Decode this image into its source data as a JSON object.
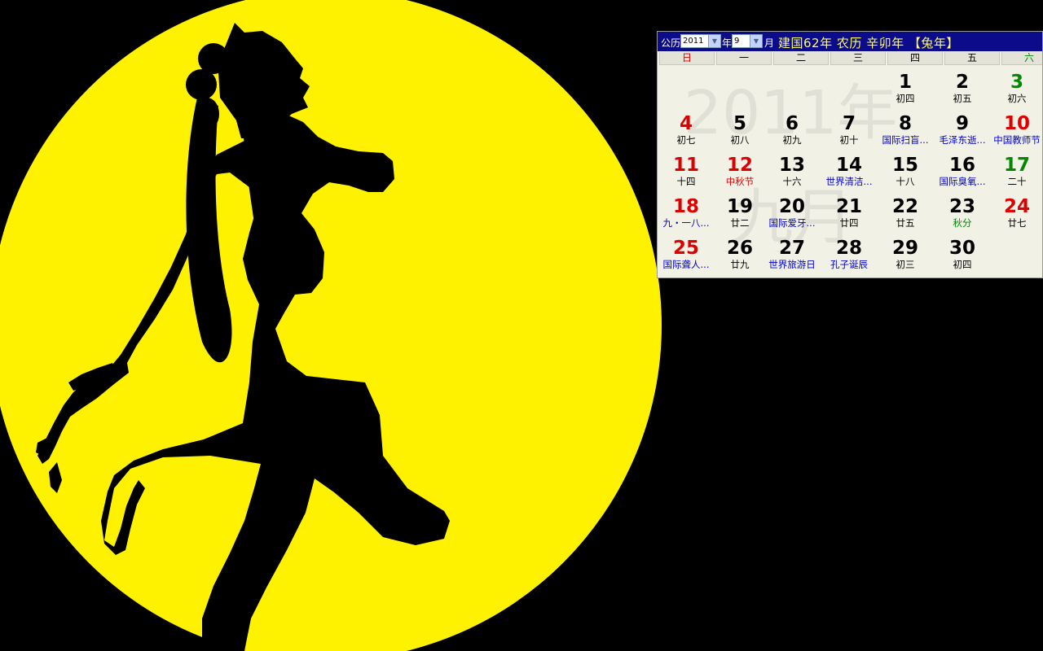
{
  "calendar": {
    "gregorian_label": "公历",
    "year_value": "2011",
    "year_suffix": "年",
    "month_value": "9",
    "month_suffix": "月",
    "info_text": "建国62年  农历  辛卯年  【兔年】",
    "watermark_year": "2011年",
    "watermark_month": "九月",
    "weekdays": [
      "日",
      "一",
      "二",
      "三",
      "四",
      "五",
      "六"
    ],
    "colors": {
      "header_bg": "#0c0c8a",
      "info_text": "#ffff66",
      "sunday": "#dd0000",
      "saturday": "#008800",
      "festival": "#0000cc",
      "panel_bg": "#f1f1e6"
    },
    "days": [
      {
        "day": "1",
        "note": "初四",
        "day_style": "",
        "note_style": ""
      },
      {
        "day": "2",
        "note": "初五",
        "day_style": "",
        "note_style": ""
      },
      {
        "day": "3",
        "note": "初六",
        "day_style": "sat",
        "note_style": ""
      },
      {
        "day": "4",
        "note": "初七",
        "day_style": "sun",
        "note_style": ""
      },
      {
        "day": "5",
        "note": "初八",
        "day_style": "",
        "note_style": ""
      },
      {
        "day": "6",
        "note": "初九",
        "day_style": "",
        "note_style": ""
      },
      {
        "day": "7",
        "note": "初十",
        "day_style": "",
        "note_style": ""
      },
      {
        "day": "8",
        "note": "国际扫盲...",
        "day_style": "",
        "note_style": "blue"
      },
      {
        "day": "9",
        "note": "毛泽东逝...",
        "day_style": "",
        "note_style": "blue"
      },
      {
        "day": "10",
        "note": "中国教师节",
        "day_style": "red",
        "note_style": "blue"
      },
      {
        "day": "11",
        "note": "十四",
        "day_style": "sun",
        "note_style": ""
      },
      {
        "day": "12",
        "note": "中秋节",
        "day_style": "red",
        "note_style": "red"
      },
      {
        "day": "13",
        "note": "十六",
        "day_style": "",
        "note_style": ""
      },
      {
        "day": "14",
        "note": "世界清洁...",
        "day_style": "",
        "note_style": "blue"
      },
      {
        "day": "15",
        "note": "十八",
        "day_style": "",
        "note_style": ""
      },
      {
        "day": "16",
        "note": "国际臭氧...",
        "day_style": "",
        "note_style": "blue"
      },
      {
        "day": "17",
        "note": "二十",
        "day_style": "sat",
        "note_style": ""
      },
      {
        "day": "18",
        "note": "九・一八...",
        "day_style": "sun",
        "note_style": "blue"
      },
      {
        "day": "19",
        "note": "廿二",
        "day_style": "",
        "note_style": ""
      },
      {
        "day": "20",
        "note": "国际爱牙...",
        "day_style": "",
        "note_style": "blue"
      },
      {
        "day": "21",
        "note": "廿四",
        "day_style": "",
        "note_style": ""
      },
      {
        "day": "22",
        "note": "廿五",
        "day_style": "",
        "note_style": ""
      },
      {
        "day": "23",
        "note": "秋分",
        "day_style": "",
        "note_style": "green"
      },
      {
        "day": "24",
        "note": "廿七",
        "day_style": "red",
        "note_style": ""
      },
      {
        "day": "25",
        "note": "国际聋人...",
        "day_style": "sun",
        "note_style": "blue"
      },
      {
        "day": "26",
        "note": "廿九",
        "day_style": "",
        "note_style": ""
      },
      {
        "day": "27",
        "note": "世界旅游日",
        "day_style": "",
        "note_style": "blue"
      },
      {
        "day": "28",
        "note": "孔子诞辰",
        "day_style": "",
        "note_style": "blue"
      },
      {
        "day": "29",
        "note": "初三",
        "day_style": "",
        "note_style": ""
      },
      {
        "day": "30",
        "note": "初四",
        "day_style": "",
        "note_style": ""
      }
    ]
  },
  "wallpaper": {
    "moon_color": "#fff200",
    "silhouette_color": "#000000",
    "background_color": "#000000"
  }
}
